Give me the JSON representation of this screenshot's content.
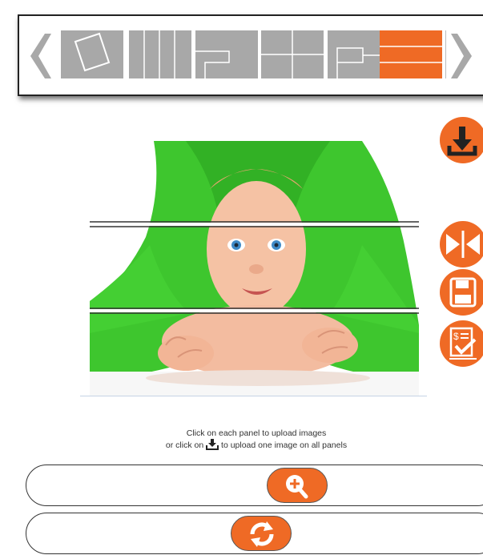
{
  "layout_picker": {
    "prev_icon": "chevron-left-icon",
    "next_icon": "chevron-right-icon",
    "thumbnails": [
      {
        "name": "tilted-single",
        "selected": false
      },
      {
        "name": "vertical-strips",
        "selected": false
      },
      {
        "name": "staircase-panels",
        "selected": false
      },
      {
        "name": "four-grid",
        "selected": false
      },
      {
        "name": "inset-panels",
        "selected": false
      },
      {
        "name": "horizontal-strips",
        "selected": true
      }
    ],
    "selected_color": "#ef6a25",
    "thumb_color": "#a8a8a8"
  },
  "preview": {
    "panels": 3,
    "subject": "baby under green towel"
  },
  "tools": [
    {
      "name": "download-icon"
    },
    {
      "name": "flip-icon"
    },
    {
      "name": "save-icon"
    },
    {
      "name": "order-icon"
    }
  ],
  "help": {
    "line1": "Click on each panel to upload images",
    "line2_prefix": "or click on",
    "line2_suffix": "to upload one image on all panels"
  },
  "controls": {
    "zoom_icon": "zoom-in-icon",
    "reset_icon": "refresh-icon"
  },
  "colors": {
    "accent": "#ef6a25",
    "towel": "#3ec62e"
  }
}
